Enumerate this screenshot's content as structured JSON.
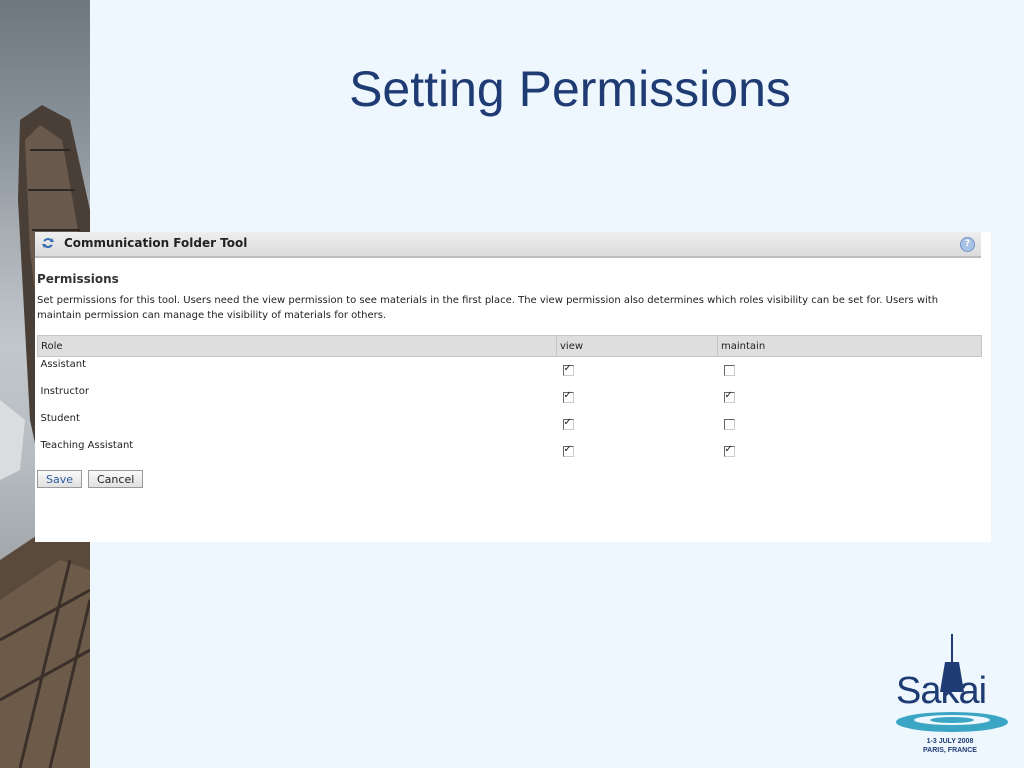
{
  "slide": {
    "title": "Setting Permissions"
  },
  "tool": {
    "title": "Communication Folder Tool",
    "help_label": "?",
    "section_heading": "Permissions",
    "instructions": "Set permissions for this tool. Users need the view permission to see materials in the first place. The view permission also determines which roles visibility can be set for. Users with maintain permission can manage the visibility of materials for others.",
    "columns": [
      "Role",
      "view",
      "maintain"
    ],
    "rows": [
      {
        "role": "Assistant",
        "view": true,
        "maintain": false
      },
      {
        "role": "Instructor",
        "view": true,
        "maintain": true
      },
      {
        "role": "Student",
        "view": true,
        "maintain": false
      },
      {
        "role": "Teaching Assistant",
        "view": true,
        "maintain": true
      }
    ],
    "buttons": {
      "save": "Save",
      "cancel": "Cancel"
    }
  },
  "logo": {
    "word": "Sakai",
    "line1": "1-3 JULY 2008",
    "line2": "PARIS, FRANCE"
  },
  "colors": {
    "title": "#1f3b73",
    "background": "#eef7fd",
    "logo_water": "#3aa6c4"
  }
}
